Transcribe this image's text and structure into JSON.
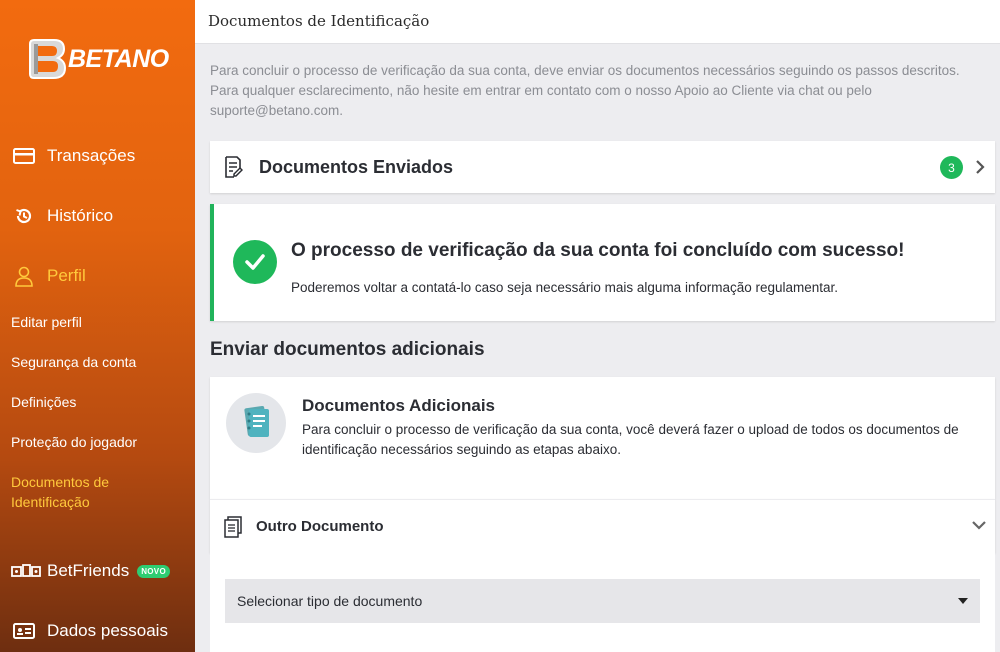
{
  "brand": {
    "name": "BETANO",
    "colors": {
      "sidebar_top": "#f26b0f",
      "sidebar_bottom": "#6e2e10",
      "active": "#ffc93c",
      "success": "#1fb85a"
    }
  },
  "sidebar": {
    "main_items": [
      {
        "label": "Transações",
        "icon": "credit-card-icon"
      },
      {
        "label": "Histórico",
        "icon": "history-icon"
      },
      {
        "label": "Perfil",
        "icon": "user-icon",
        "active": true
      }
    ],
    "profile_subitems": [
      {
        "label": "Editar perfil"
      },
      {
        "label": "Segurança da conta"
      },
      {
        "label": "Definições"
      },
      {
        "label": "Proteção do jogador"
      },
      {
        "label": "Documentos de Identificação",
        "active": true
      }
    ],
    "betfriends": {
      "label": "BetFriends",
      "badge": "NOVO",
      "icon": "betfriends-icon"
    },
    "personal_data": {
      "label": "Dados pessoais",
      "icon": "id-card-icon"
    }
  },
  "header": {
    "title": "Documentos de Identificação"
  },
  "intro": {
    "text": "Para concluir o processo de verificação da sua conta, deve enviar os documentos necessários seguindo os passos descritos. Para qualquer esclarecimento, não hesite em entrar em contato com o nosso Apoio ao Cliente via chat ou pelo suporte@betano.com."
  },
  "sent_documents": {
    "label": "Documentos Enviados",
    "count": "3",
    "icon": "document-edit-icon"
  },
  "verification": {
    "title": "O processo de verificação da sua conta foi concluído com sucesso!",
    "text": "Poderemos voltar a contatá-lo caso seja necessário mais alguma informação regulamentar.",
    "icon": "check-icon"
  },
  "additional_section": {
    "title": "Enviar documentos adicionais"
  },
  "additional_card": {
    "title": "Documentos Adicionais",
    "text": "Para concluir o processo de verificação da sua conta, você deverá fazer o upload de todos os documentos de identificação necessários seguindo as etapas abaixo.",
    "icon": "notebook-icon"
  },
  "other_document": {
    "label": "Outro Documento",
    "icon": "documents-icon"
  },
  "select": {
    "value": "Selecionar tipo de documento"
  }
}
